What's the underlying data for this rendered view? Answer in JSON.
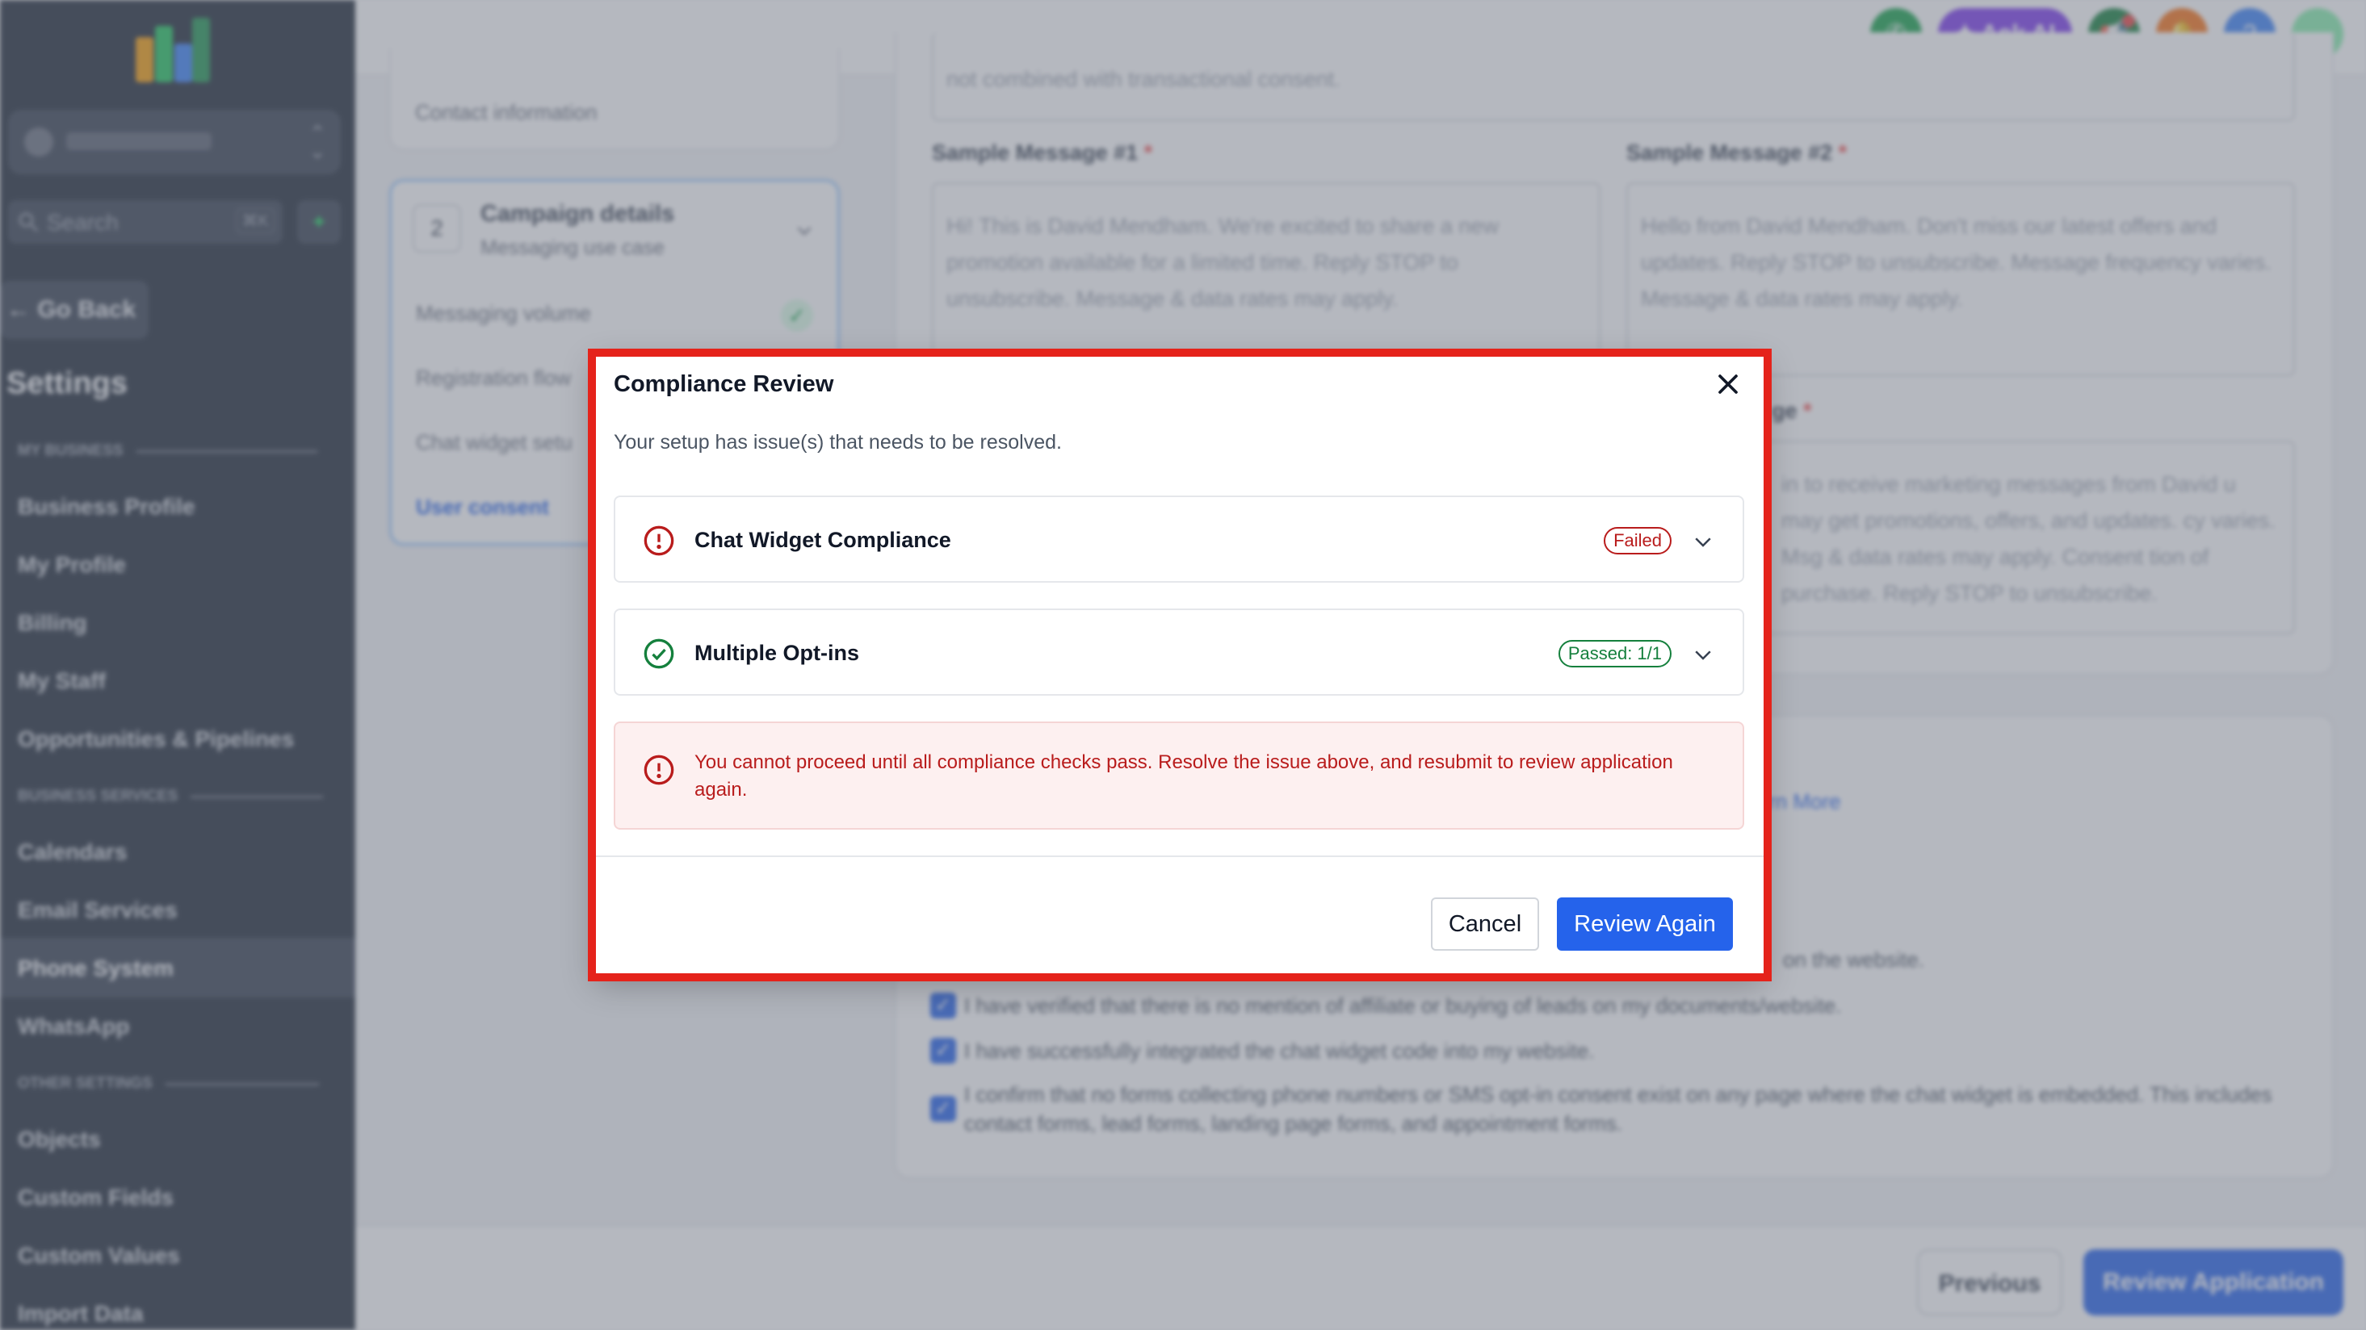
{
  "sidebar": {
    "search_label": "Search",
    "search_shortcut": "⌘K",
    "go_back": "Go Back",
    "title": "Settings",
    "sections": {
      "my_business": "MY BUSINESS",
      "business_services": "BUSINESS SERVICES",
      "other_settings": "OTHER SETTINGS"
    },
    "items": {
      "business_profile": "Business Profile",
      "my_profile": "My Profile",
      "billing": "Billing",
      "my_staff": "My Staff",
      "opportunities": "Opportunities & Pipelines",
      "calendars": "Calendars",
      "email_services": "Email Services",
      "phone_system": "Phone System",
      "whatsapp": "WhatsApp",
      "objects": "Objects",
      "custom_fields": "Custom Fields",
      "custom_values": "Custom Values",
      "import_data": "Import Data"
    }
  },
  "topbar": {
    "ask_ai": "Ask AI",
    "help": "?"
  },
  "steps": {
    "contact_info": "Contact information",
    "step_number": "2",
    "campaign_title": "Campaign details",
    "campaign_sub": "Messaging use case",
    "messaging_volume": "Messaging volume",
    "registration_flow": "Registration flow",
    "chat_widget_setup": "Chat widget setu",
    "user_consent": "User consent"
  },
  "form": {
    "top_text": "not combined with transactional consent.",
    "sample1_label": "Sample Message #1",
    "sample1_text": "Hi! This is David Mendham. We're excited to share a new promotion available for a limited time. Reply STOP to unsubscribe. Message & data rates may apply.",
    "sample2_label": "Sample Message #2",
    "sample2_text": "Hello from David Mendham. Don't miss our latest offers and updates. Reply STOP to unsubscribe. Message frequency varies. Message & data rates may apply.",
    "consent_label_frag": "ge",
    "consent_text": "in to receive marketing messages from David u may get promotions, offers, and updates. cy varies. Msg & data rates may apply. Consent tion of purchase. Reply STOP to unsubscribe.",
    "learn_more": "rn More",
    "website_frag": "on the website.",
    "check1": "I have verified that there is no mention of affiliate or buying of leads on my documents/website.",
    "check2": "I have successfully integrated the chat widget code into my website.",
    "check3": "I confirm that no forms collecting phone numbers or SMS opt-in consent exist on any page where the chat widget is embedded. This includes contact forms, lead forms, landing page forms, and appointment forms."
  },
  "footer": {
    "previous": "Previous",
    "review_application": "Review Application"
  },
  "modal": {
    "title": "Compliance Review",
    "subtitle": "Your setup has issue(s) that needs to be resolved.",
    "checks": [
      {
        "name": "Chat Widget Compliance",
        "status": "Failed",
        "status_type": "error-icon"
      },
      {
        "name": "Multiple Opt-ins",
        "status": "Passed: 1/1",
        "status_type": "check-circle-icon"
      }
    ],
    "alert": "You cannot proceed until all compliance checks pass. Resolve the issue above, and resubmit to review application again.",
    "cancel": "Cancel",
    "review_again": "Review Again"
  },
  "colors": {
    "primary": "#2563eb",
    "error": "#b91c1c",
    "success": "#15803d",
    "highlight_frame": "#e5231b",
    "sidebar_bg": "#1f2937"
  }
}
